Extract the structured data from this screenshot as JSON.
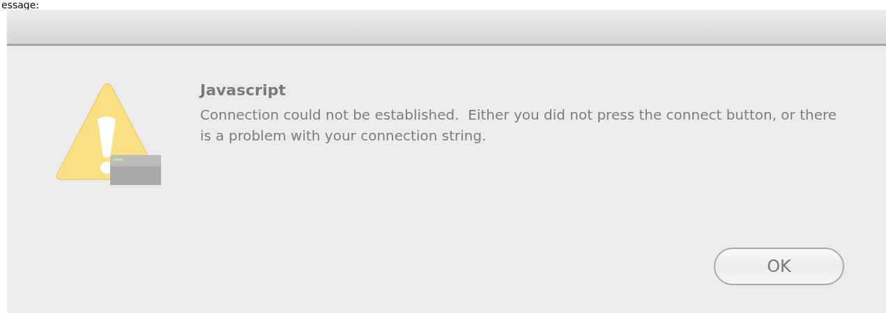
{
  "page_caption": "essage:",
  "dialog": {
    "title": "Javascript",
    "message": "Connection could not be established.  Either you did not press the connect button, or there is a problem with your connection string.",
    "buttons": [
      "OK"
    ]
  }
}
